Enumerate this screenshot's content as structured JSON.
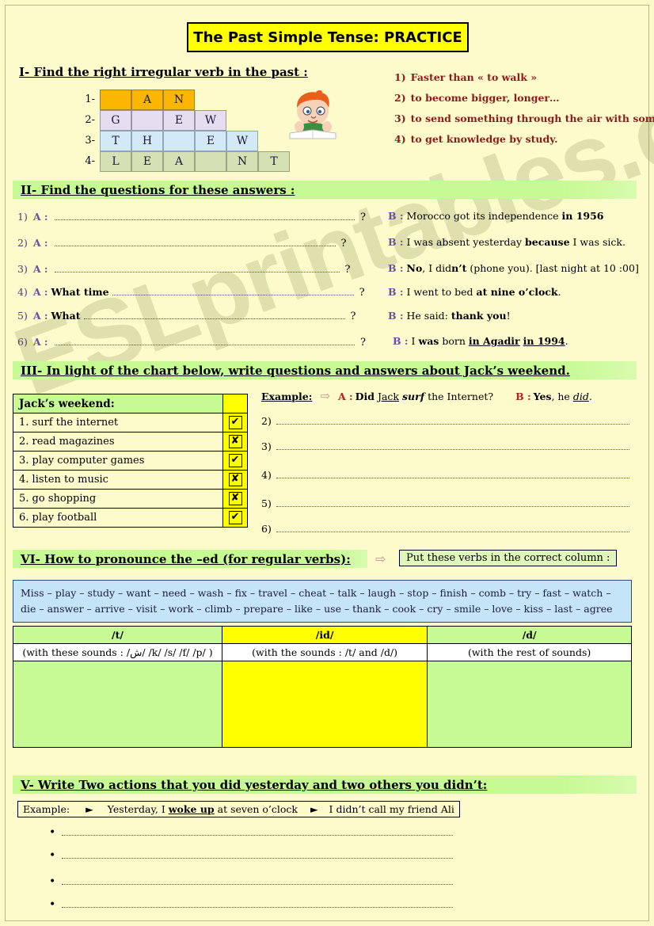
{
  "title": "The Past Simple Tense: PRACTICE",
  "watermark": "ESLprintables.com",
  "section1": {
    "heading": "I- Find the right irregular verb in the past :",
    "rows": [
      {
        "num": "1-",
        "cells": [
          "",
          "A",
          "N"
        ]
      },
      {
        "num": "2-",
        "cells": [
          "G",
          "",
          "E",
          "W"
        ]
      },
      {
        "num": "3-",
        "cells": [
          "T",
          "H",
          "",
          "E",
          "W"
        ]
      },
      {
        "num": "4-",
        "cells": [
          "L",
          "E",
          "A",
          "",
          "N",
          "T"
        ]
      }
    ],
    "clues": [
      {
        "num": "1)",
        "text": "Faster than « to walk »"
      },
      {
        "num": "2)",
        "text": "to become bigger, longer…"
      },
      {
        "num": "3)",
        "text": "to send something through the air with some force."
      },
      {
        "num": "4)",
        "text": "to get knowledge by study."
      }
    ],
    "image_name": "boy-reading-illustration"
  },
  "section2": {
    "heading": "II- Find the questions for these answers :",
    "questions": [
      {
        "num": "1)",
        "a_label": "A :",
        "prefix": "",
        "qmark": "?"
      },
      {
        "num": "2)",
        "a_label": "A :",
        "prefix": "",
        "qmark": "?"
      },
      {
        "num": "3)",
        "a_label": "A :",
        "prefix": "",
        "qmark": "?"
      },
      {
        "num": "4)",
        "a_label": "A :",
        "prefix": "What time",
        "qmark": "?"
      },
      {
        "num": "5)",
        "a_label": "A :",
        "prefix": "What",
        "qmark": "?"
      },
      {
        "num": "6)",
        "a_label": "A :",
        "prefix": "",
        "qmark": "?"
      }
    ],
    "answers": [
      {
        "b_label": "B :",
        "parts": [
          {
            "t": "Morocco got its independence ",
            "s": "n"
          },
          {
            "t": "in 1956",
            "s": "b"
          }
        ]
      },
      {
        "b_label": "B :",
        "parts": [
          {
            "t": "I was absent yesterday ",
            "s": "n"
          },
          {
            "t": "because",
            "s": "b"
          },
          {
            "t": " I was sick.",
            "s": "n"
          }
        ]
      },
      {
        "b_label": "B :",
        "parts": [
          {
            "t": "No",
            "s": "b"
          },
          {
            "t": ", I did",
            "s": "n"
          },
          {
            "t": "n’t",
            "s": "b"
          },
          {
            "t": " (phone you).  [last night at 10 :00]",
            "s": "n"
          }
        ]
      },
      {
        "b_label": "B :",
        "parts": [
          {
            "t": "I went to bed ",
            "s": "n"
          },
          {
            "t": "at nine o’clock",
            "s": "b"
          },
          {
            "t": ".",
            "s": "n"
          }
        ]
      },
      {
        "b_label": "B :",
        "parts": [
          {
            "t": "He said: ",
            "s": "n"
          },
          {
            "t": "thank you",
            "s": "b"
          },
          {
            "t": "!",
            "s": "n"
          }
        ]
      },
      {
        "b_label": "B :",
        "parts": [
          {
            "t": "I ",
            "s": "n"
          },
          {
            "t": "was",
            "s": "b"
          },
          {
            "t": " born ",
            "s": "n"
          },
          {
            "t": "in Agadir",
            "s": "bu"
          },
          {
            "t": " ",
            "s": "n"
          },
          {
            "t": "in 1994",
            "s": "bu"
          },
          {
            "t": ".",
            "s": "n"
          }
        ]
      }
    ]
  },
  "section3": {
    "heading": "III- In light of the chart below, write questions and answers about Jack’s weekend.",
    "table_title": "Jack’s weekend:",
    "rows": [
      {
        "label": "1. surf the internet",
        "mark": "✔"
      },
      {
        "label": "2. read magazines",
        "mark": "✘"
      },
      {
        "label": "3. play computer games",
        "mark": "✔"
      },
      {
        "label": "4. listen to music",
        "mark": "✘"
      },
      {
        "label": "5. go shopping",
        "mark": "✘"
      },
      {
        "label": "6. play football",
        "mark": "✔"
      }
    ],
    "example": {
      "label": "Example:",
      "arrow_icon": "right-arrow-icon",
      "a_label": "A :",
      "a_text_1": "Did",
      "a_text_2": "Jack",
      "a_text_3": "surf",
      "a_text_4": "the Internet?",
      "b_label": "B :",
      "b_text_1": "Yes",
      "b_text_2": ", he",
      "b_text_3": "did",
      "b_text_4": "."
    },
    "blank_numbers": [
      "2)",
      "3)",
      "4)",
      "5)",
      "6)"
    ]
  },
  "section4": {
    "heading": "VI- How to pronounce the –ed (for regular verbs):",
    "arrow_icon": "right-arrow-icon",
    "put_box": "Put these verbs in the correct column :",
    "verbs_line_1": "Miss – play – study – want – need – wash – fix – travel – cheat – talk – laugh – stop – finish – comb – try – fast – watch –",
    "verbs_line_2": "die – answer – arrive – visit – work – climb – prepare – like – use – thank – cook – cry – smile – love – kiss – last – agree",
    "columns": [
      {
        "header": "/t/",
        "sub": "(with these sounds : /ش/ /k/ /s/ /f/ /p/ )",
        "color": "green"
      },
      {
        "header": "/id/",
        "sub": "(with the sounds : /t/ and /d/)",
        "color": "yellow"
      },
      {
        "header": "/d/",
        "sub": "(with the rest of sounds)",
        "color": "green"
      }
    ]
  },
  "section5": {
    "heading": "V- Write Two actions that you did yesterday and two others you didn’t:",
    "example": {
      "label": "Example:",
      "arrow1": "►",
      "text1_a": "Yesterday, I ",
      "text1_b": "woke up",
      "text1_c": " at seven o’clock",
      "arrow2": "►",
      "text2": "I didn’t call my friend Ali"
    },
    "bullets": [
      "•",
      "•",
      "•",
      "•"
    ]
  },
  "colors": {
    "page_bg": "#FDFBCB",
    "title_bg": "#FFFF00",
    "band_green": "#C6FA92",
    "yellow": "#FFFF00",
    "verbs_box_bg": "#C6E4F7",
    "clue_red": "#8C1A1A",
    "label_purple": "#6B4FA0",
    "row1": "#FBB600",
    "row2": "#E7DDF0",
    "row3": "#D4E9F7",
    "row4": "#D5E0B5"
  }
}
